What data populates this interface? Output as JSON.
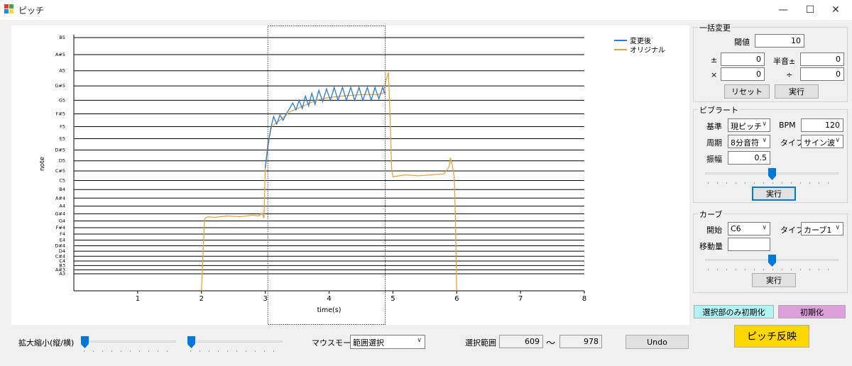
{
  "window": {
    "title": "ピッチ",
    "minimize": "—",
    "maximize": "☐",
    "close": "✕"
  },
  "chart_data": {
    "type": "line",
    "xlabel": "time(s)",
    "ylabel": "note",
    "xlim": [
      0,
      8
    ],
    "x_ticks": [
      "1",
      "2",
      "3",
      "4",
      "5",
      "6",
      "7",
      "8"
    ],
    "notes": [
      "A3",
      "A#3",
      "B3",
      "C4",
      "C#4",
      "D4",
      "D#4",
      "E4",
      "F4",
      "F#4",
      "G4",
      "G#4",
      "A4",
      "A#4",
      "B4",
      "C5",
      "C#5",
      "D5",
      "D#5",
      "E5",
      "F5",
      "F#5",
      "G5",
      "G#5",
      "A5",
      "A#5",
      "B5"
    ],
    "grid": true,
    "legend": "top-right",
    "selection_time": [
      3.04,
      4.88
    ],
    "series": [
      {
        "name": "変更後",
        "color": "#2b7bd4",
        "points": [
          [
            3.0,
            61.3
          ],
          [
            3.04,
            63.2
          ],
          [
            3.08,
            64.7
          ],
          [
            3.13,
            65.8
          ],
          [
            3.18,
            65.2
          ],
          [
            3.23,
            65.9
          ],
          [
            3.28,
            65.5
          ],
          [
            3.33,
            66.0
          ],
          [
            3.38,
            66.4
          ],
          [
            3.43,
            66.8
          ],
          [
            3.48,
            66.3
          ],
          [
            3.53,
            67.0
          ],
          [
            3.58,
            66.4
          ],
          [
            3.63,
            67.3
          ],
          [
            3.68,
            66.6
          ],
          [
            3.73,
            67.5
          ],
          [
            3.78,
            66.7
          ],
          [
            3.84,
            67.7
          ],
          [
            3.9,
            66.9
          ],
          [
            3.96,
            67.8
          ],
          [
            4.02,
            67.0
          ],
          [
            4.08,
            67.9
          ],
          [
            4.14,
            67.0
          ],
          [
            4.21,
            67.9
          ],
          [
            4.27,
            67.0
          ],
          [
            4.34,
            67.9
          ],
          [
            4.4,
            67.0
          ],
          [
            4.47,
            67.9
          ],
          [
            4.53,
            67.0
          ],
          [
            4.6,
            67.9
          ],
          [
            4.66,
            67.0
          ],
          [
            4.72,
            67.9
          ],
          [
            4.78,
            67.1
          ],
          [
            4.84,
            67.9
          ],
          [
            4.88,
            67.4
          ]
        ]
      },
      {
        "name": "オリジナル",
        "color": "#e8a33d",
        "points": [
          [
            2.0,
            40.0
          ],
          [
            2.02,
            48.0
          ],
          [
            2.05,
            55.3
          ],
          [
            2.1,
            55.6
          ],
          [
            2.2,
            55.5
          ],
          [
            2.4,
            55.7
          ],
          [
            2.6,
            55.6
          ],
          [
            2.8,
            55.8
          ],
          [
            2.9,
            55.7
          ],
          [
            2.95,
            56.1
          ],
          [
            2.98,
            55.4
          ],
          [
            3.0,
            61.3
          ],
          [
            3.04,
            63.6
          ],
          [
            3.1,
            65.0
          ],
          [
            3.2,
            65.4
          ],
          [
            3.4,
            66.2
          ],
          [
            3.6,
            66.6
          ],
          [
            3.8,
            67.0
          ],
          [
            4.0,
            67.2
          ],
          [
            4.2,
            67.3
          ],
          [
            4.5,
            67.4
          ],
          [
            4.75,
            67.4
          ],
          [
            4.85,
            67.5
          ],
          [
            4.9,
            68.5
          ],
          [
            4.93,
            68.9
          ],
          [
            4.96,
            65.2
          ],
          [
            4.98,
            61.2
          ],
          [
            5.0,
            60.4
          ],
          [
            5.2,
            60.6
          ],
          [
            5.4,
            60.5
          ],
          [
            5.6,
            60.6
          ],
          [
            5.8,
            60.7
          ],
          [
            5.88,
            61.4
          ],
          [
            5.9,
            62.3
          ],
          [
            5.93,
            61.6
          ],
          [
            5.96,
            60.5
          ],
          [
            5.98,
            55.0
          ],
          [
            6.0,
            40.0
          ]
        ]
      }
    ]
  },
  "bulk": {
    "title": "一括変更",
    "threshold_label": "閾値",
    "threshold_value": "10",
    "pm_label": "±",
    "pm_value": "0",
    "semitone_label": "半音±",
    "semitone_value": "0",
    "mul_label": "×",
    "mul_value": "0",
    "div_label": "÷",
    "div_value": "0",
    "reset_label": "リセット",
    "run_label": "実行"
  },
  "vibrato": {
    "title": "ビブラート",
    "base_label": "基準",
    "base_value": "現ピッチ",
    "bpm_label": "BPM",
    "bpm_value": "120",
    "period_label": "周期",
    "period_value": "8分音符",
    "type_label": "タイプ",
    "type_value": "サイン波",
    "amp_label": "振幅",
    "amp_value": "0.5",
    "slider_value": 0.5,
    "run_label": "実行"
  },
  "curve": {
    "title": "カーブ",
    "start_label": "開始",
    "start_value": "C6",
    "type_label": "タイプ",
    "type_value": "カーブ1",
    "move_label": "移動量",
    "move_value": "",
    "slider_value": 0.5,
    "run_label": "実行"
  },
  "bottom": {
    "zoom_label": "拡大縮小(縦/横)",
    "zoom_v_value": 0.0,
    "zoom_h_value": 0.0,
    "mouse_mode_label": "マウスモード",
    "mouse_mode_value": "範囲選択",
    "selection_range_label": "選択範囲",
    "sel_start": "609",
    "tilde": "〜",
    "sel_end": "978",
    "undo_label": "Undo"
  },
  "actions": {
    "init_selection_label": "選択部のみ初期化",
    "init_selection_color": "#b2f4f4",
    "init_all_label": "初期化",
    "init_all_color": "#dda0dd",
    "apply_label": "ピッチ反映",
    "apply_color": "#ffd700"
  },
  "colors": {
    "accent": "#0078d7",
    "series_changed": "#2b7bd4",
    "series_original": "#e8a33d"
  }
}
